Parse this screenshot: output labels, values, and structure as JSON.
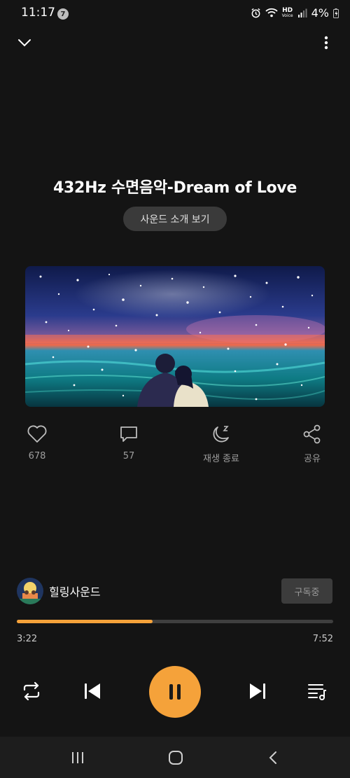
{
  "status_bar": {
    "time": "11:17",
    "notification_count": "7",
    "hd_label_top": "HD",
    "hd_label_bottom": "Voice",
    "battery": "4%"
  },
  "track": {
    "title": "432Hz 수면음악-Dream of Love",
    "intro_button": "사운드 소개 보기"
  },
  "actions": {
    "like_count": "678",
    "comment_count": "57",
    "sleep_timer": "재생 종료",
    "share": "공유"
  },
  "channel": {
    "name": "힐링사운드",
    "subscribe_label": "구독중"
  },
  "player": {
    "elapsed": "3:22",
    "total": "7:52",
    "progress": 0.43,
    "accent_color": "#f5a23a",
    "state": "playing"
  },
  "icons": {
    "header": [
      "chevron-down-icon",
      "more-vertical-icon"
    ],
    "actions": [
      "heart-icon",
      "comment-icon",
      "moon-sleep-icon",
      "share-icon"
    ],
    "controls": [
      "repeat-icon",
      "skip-previous-icon",
      "pause-icon",
      "skip-next-icon",
      "playlist-icon"
    ],
    "nav": [
      "recent-apps-icon",
      "home-icon",
      "back-icon"
    ]
  }
}
